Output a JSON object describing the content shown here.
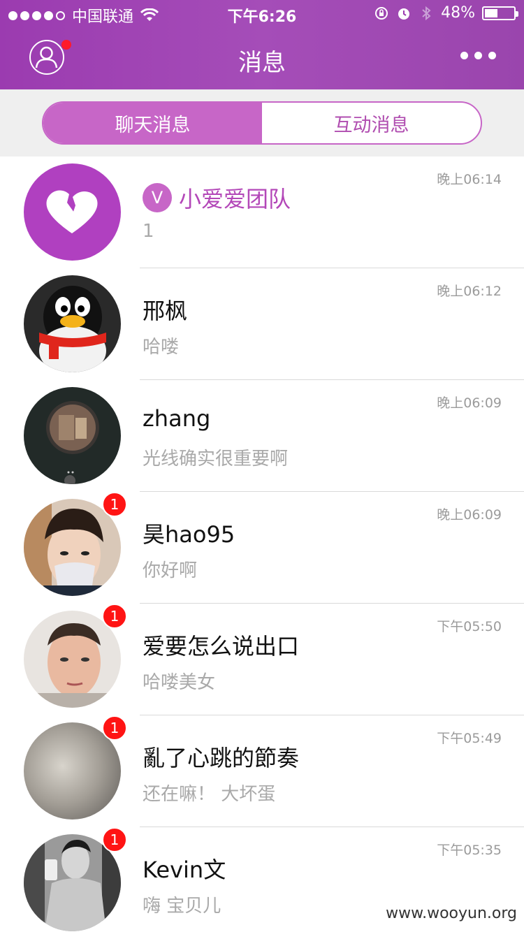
{
  "status_bar": {
    "carrier": "中国联通",
    "time": "下午6:26",
    "battery": "48%",
    "battery_level": 0.48
  },
  "header": {
    "title": "消息",
    "profile_icon": "user-circle-icon",
    "more_icon": "more-horizontal-icon"
  },
  "tabs": [
    {
      "label": "聊天消息",
      "active": true
    },
    {
      "label": "互动消息",
      "active": false
    }
  ],
  "conversations": [
    {
      "name": "小爱爱团队",
      "preview": "1",
      "time": "晚上06:14",
      "badge": "",
      "official_mark": "V",
      "avatar": "heart-logo-avatar"
    },
    {
      "name": "邢枫",
      "preview": "哈喽",
      "time": "晚上06:12",
      "badge": "",
      "avatar": "penguin-avatar"
    },
    {
      "name": "zhang",
      "preview": "光线确实很重要啊",
      "time": "晚上06:09",
      "badge": "",
      "avatar": "camera-avatar"
    },
    {
      "name": "昊hao95",
      "preview": "你好啊",
      "time": "晚上06:09",
      "badge": "1",
      "avatar": "masked-man-avatar"
    },
    {
      "name": "爱要怎么说出口",
      "preview": "哈喽美女",
      "time": "下午05:50",
      "badge": "1",
      "avatar": "man-selfie-avatar"
    },
    {
      "name": "亂了心跳的節奏",
      "preview": "还在嘛！ 大坏蛋",
      "time": "下午05:49",
      "badge": "1",
      "avatar": "blurred-avatar"
    },
    {
      "name": "Kevin文",
      "preview": "嗨 宝贝儿",
      "time": "下午05:35",
      "badge": "1",
      "avatar": "gym-selfie-avatar"
    }
  ],
  "watermark": "www.wooyun.org",
  "colors": {
    "header": "#9b3bb0",
    "accent": "#c766c7",
    "badge": "#ff1414"
  }
}
